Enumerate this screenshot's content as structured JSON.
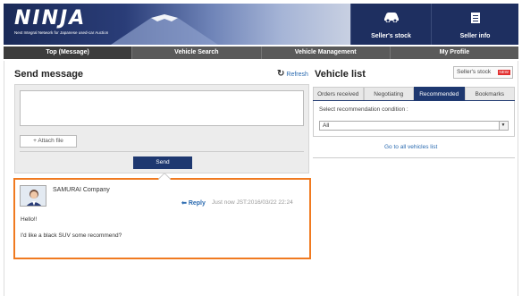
{
  "header": {
    "logo": "NINJA",
    "logo_sub": "Next Integral Network for Japanese used-car Auction",
    "stock_label": "Seller's stock",
    "seller_label": "Seller info",
    "stock_icon": "car-icon",
    "seller_icon": "document-icon",
    "brand_color": "#1e2f60"
  },
  "nav": {
    "items": [
      "Top (Message)",
      "Vehicle Search",
      "Vehicle Management",
      "My Profile"
    ]
  },
  "left": {
    "title": "Send message",
    "refresh_label": "Refresh",
    "message_value": "",
    "attach_label": "+ Attach file",
    "send_label": "Send",
    "highlight_color": "#f07a20"
  },
  "message": {
    "company": "SAMURAI Company",
    "reply_label": "Reply",
    "timestamp": "Just now JST:2016/03/22 22:24",
    "line1": "Hello!!",
    "line2": "I'd like a black SUV some recommend?"
  },
  "right": {
    "title": "Vehicle list",
    "seller_stock_label": "Seller's stock",
    "new_badge": "NEW",
    "tabs": [
      "Orders received",
      "Negotiating",
      "Recommended",
      "Bookmarks"
    ],
    "active_tab": "Recommended",
    "condition_label": "Select recommendation condition :",
    "condition_value": "All",
    "all_link": "Go to all vehicles list"
  }
}
